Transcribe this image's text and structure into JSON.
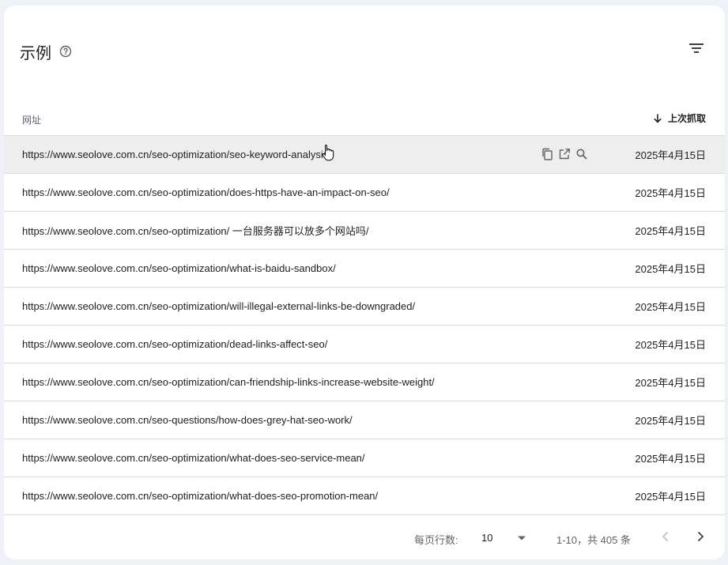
{
  "card": {
    "title": "示例"
  },
  "table": {
    "col_url": "网址",
    "col_date": "上次抓取",
    "rows": [
      {
        "url": "https://www.seolove.com.cn/seo-optimization/seo-keyword-analysis/",
        "date": "2025年4月15日"
      },
      {
        "url": "https://www.seolove.com.cn/seo-optimization/does-https-have-an-impact-on-seo/",
        "date": "2025年4月15日"
      },
      {
        "url": "https://www.seolove.com.cn/seo-optimization/ 一台服务器可以放多个网站吗/",
        "date": "2025年4月15日"
      },
      {
        "url": "https://www.seolove.com.cn/seo-optimization/what-is-baidu-sandbox/",
        "date": "2025年4月15日"
      },
      {
        "url": "https://www.seolove.com.cn/seo-optimization/will-illegal-external-links-be-downgraded/",
        "date": "2025年4月15日"
      },
      {
        "url": "https://www.seolove.com.cn/seo-optimization/dead-links-affect-seo/",
        "date": "2025年4月15日"
      },
      {
        "url": "https://www.seolove.com.cn/seo-optimization/can-friendship-links-increase-website-weight/",
        "date": "2025年4月15日"
      },
      {
        "url": "https://www.seolove.com.cn/seo-questions/how-does-grey-hat-seo-work/",
        "date": "2025年4月15日"
      },
      {
        "url": "https://www.seolove.com.cn/seo-optimization/what-does-seo-service-mean/",
        "date": "2025年4月15日"
      },
      {
        "url": "https://www.seolove.com.cn/seo-optimization/what-does-seo-promotion-mean/",
        "date": "2025年4月15日"
      }
    ]
  },
  "footer": {
    "rows_per_page_label": "每页行数:",
    "rows_per_page_value": "10",
    "range_text": "1-10，共 405 条"
  },
  "icons": {
    "help": "help-circle-icon",
    "filter": "filter-icon",
    "sort": "arrow-down-icon",
    "copy": "copy-icon",
    "open": "open-in-new-icon",
    "inspect": "search-icon",
    "prev": "chevron-left-icon",
    "next": "chevron-right-icon"
  },
  "colors": {
    "page_bg": "#eef1f5",
    "card_bg": "#ffffff",
    "hover_row": "#eeeeee",
    "divider": "#dadce0",
    "text": "#202124",
    "muted": "#5f6368"
  }
}
